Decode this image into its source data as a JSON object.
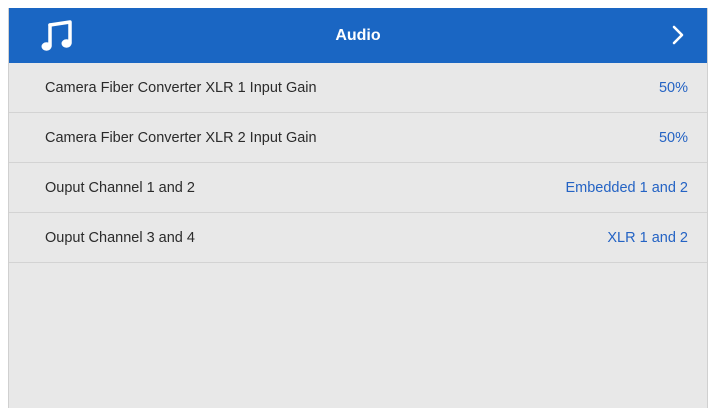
{
  "header": {
    "title": "Audio",
    "icon": "music-note-icon",
    "nav_icon": "chevron-right-icon",
    "color": "#1a66c3"
  },
  "settings": [
    {
      "label": "Camera Fiber Converter XLR 1 Input Gain",
      "value": "50%"
    },
    {
      "label": "Camera Fiber Converter XLR 2 Input Gain",
      "value": "50%"
    },
    {
      "label": "Ouput Channel 1 and 2",
      "value": "Embedded 1 and 2"
    },
    {
      "label": "Ouput Channel 3 and 4",
      "value": "XLR 1 and 2"
    }
  ],
  "colors": {
    "background": "#e8e8e8",
    "value_text": "#2463c4",
    "label_text": "#2b2b2b"
  }
}
